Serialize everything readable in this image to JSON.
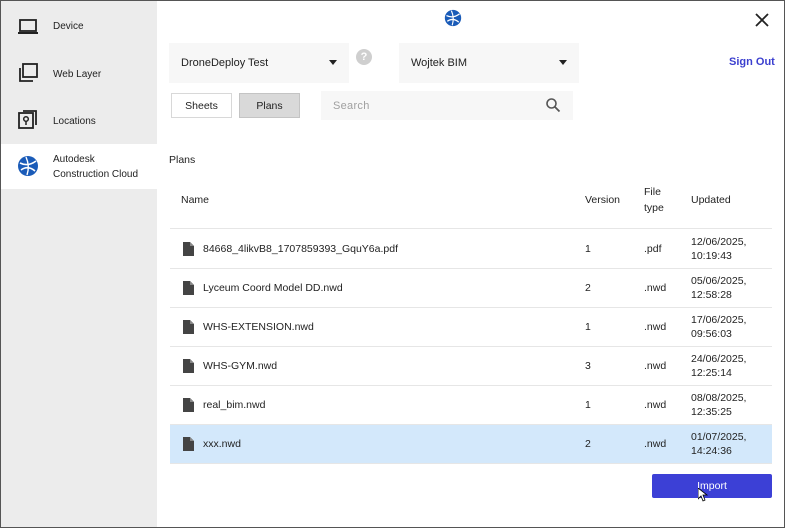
{
  "sidebar": {
    "items": [
      {
        "label": "Device",
        "icon": "laptop-icon"
      },
      {
        "label": "Web Layer",
        "icon": "layers-icon"
      },
      {
        "label": "Locations",
        "icon": "map-pin-icon"
      },
      {
        "label": "Autodesk Construction Cloud",
        "icon": "autodesk-globe-icon"
      }
    ]
  },
  "header": {
    "logo_icon": "autodesk-globe-icon",
    "project_select": "DroneDeploy Test",
    "help_glyph": "?",
    "account_select": "Wojtek BIM",
    "sign_out": "Sign Out"
  },
  "tabs": {
    "sheets": "Sheets",
    "plans": "Plans",
    "active": "Plans"
  },
  "search": {
    "placeholder": "Search"
  },
  "section_title": "Plans",
  "table": {
    "headers": {
      "name": "Name",
      "version": "Version",
      "file_type": "File type",
      "updated": "Updated"
    },
    "rows": [
      {
        "name": "84668_4likvB8_1707859393_GquY6a.pdf",
        "version": "1",
        "type": ".pdf",
        "updated": "12/06/2025, 10:19:43"
      },
      {
        "name": "Lyceum Coord Model DD.nwd",
        "version": "2",
        "type": ".nwd",
        "updated": "05/06/2025, 12:58:28"
      },
      {
        "name": "WHS-EXTENSION.nwd",
        "version": "1",
        "type": ".nwd",
        "updated": "17/06/2025, 09:56:03"
      },
      {
        "name": "WHS-GYM.nwd",
        "version": "3",
        "type": ".nwd",
        "updated": "24/06/2025, 12:25:14"
      },
      {
        "name": "real_bim.nwd",
        "version": "1",
        "type": ".nwd",
        "updated": "08/08/2025, 12:35:25"
      },
      {
        "name": "xxx.nwd",
        "version": "2",
        "type": ".nwd",
        "updated": "01/07/2025, 14:24:36",
        "selected": true
      }
    ]
  },
  "import_button": "Import",
  "colors": {
    "accent": "#3c40d6",
    "signout": "#3b3fcf",
    "selected_row": "#d3e8fb",
    "sidebar_bg": "#ececec"
  }
}
